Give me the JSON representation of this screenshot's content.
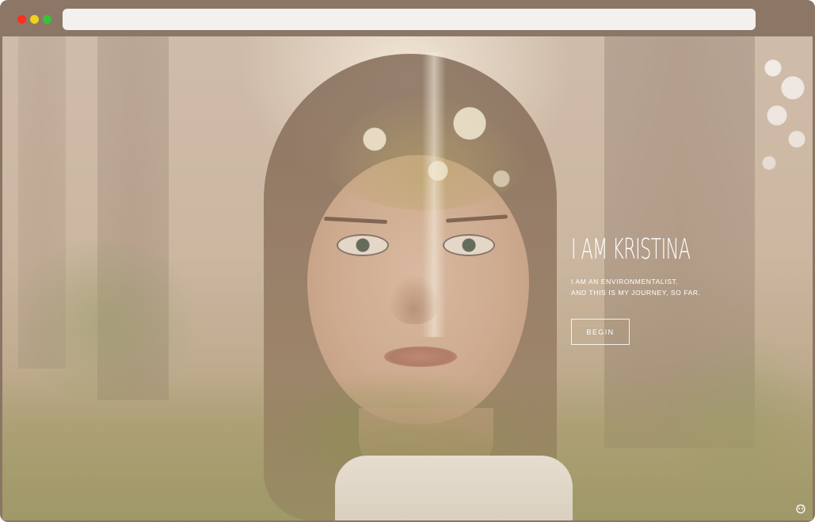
{
  "browser": {
    "window_controls": [
      "close",
      "minimize",
      "maximize"
    ],
    "address_bar_value": ""
  },
  "hero": {
    "title": "I AM KRISTINA",
    "subtitle_line1": "I AM AN ENVIRONMENTALIST.",
    "subtitle_line2": "AND THIS IS MY JOURNEY, SO FAR.",
    "begin_label": "BEGIN"
  },
  "icons": {
    "corner": "owl-logo-icon"
  },
  "colors": {
    "titlebar": "#8c7767",
    "close": "#ff2d1f",
    "minimize": "#f1d21a",
    "maximize": "#38c43a",
    "hero_text": "#ffffff"
  }
}
